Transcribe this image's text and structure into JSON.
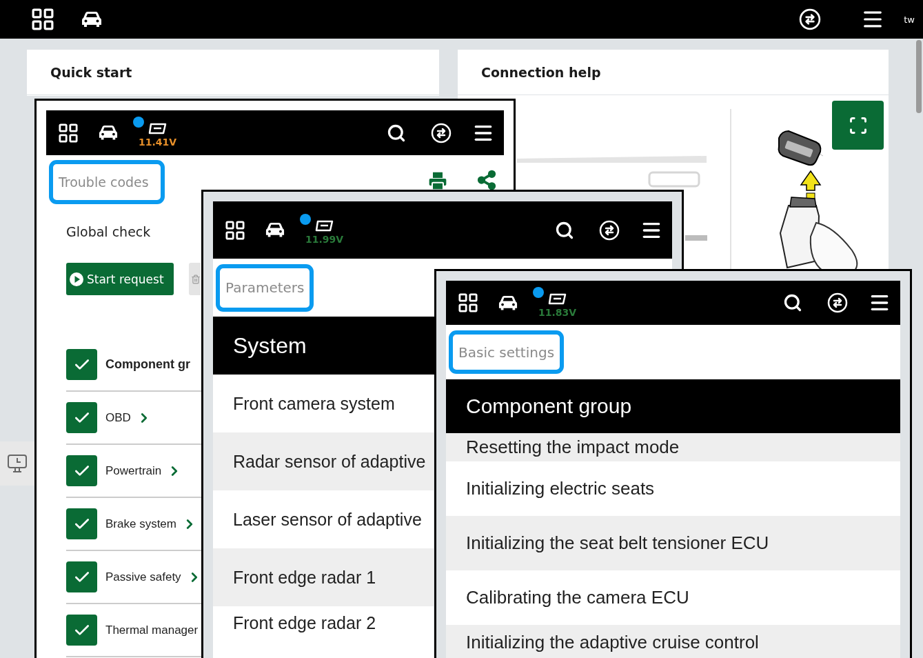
{
  "top_bar": {
    "user": "tw"
  },
  "cards": [
    {
      "title": "Quick start"
    },
    {
      "title": "Connection help"
    }
  ],
  "screenshots": [
    {
      "kind": "trouble_codes",
      "voltage": "11.41V",
      "color": "#e8902a",
      "field": "Trouble codes",
      "section": "Global check",
      "start_button": "Start request",
      "header_row": {
        "label": "Component gr",
        "checked": true
      },
      "rows": [
        {
          "label": "OBD",
          "checked": true
        },
        {
          "label": "Powertrain",
          "checked": true
        },
        {
          "label": "Brake system",
          "checked": true
        },
        {
          "label": "Passive safety",
          "checked": true
        },
        {
          "label": "Thermal manager",
          "checked": true
        }
      ]
    },
    {
      "kind": "list",
      "voltage": "11.99V",
      "color": "#2a7a3a",
      "field": "Parameters",
      "section": "System",
      "rows": [
        {
          "label": "Front camera system"
        },
        {
          "label": "Radar sensor of adaptive"
        },
        {
          "label": "Laser sensor of adaptive"
        },
        {
          "label": "Front edge radar 1"
        },
        {
          "label": "Front edge radar 2"
        }
      ]
    },
    {
      "kind": "list",
      "voltage": "11.83V",
      "color": "#2a7a3a",
      "field": "Basic settings",
      "section": "Component group",
      "partial_row": "Resetting the impact mode",
      "rows": [
        {
          "label": "Initializing electric seats"
        },
        {
          "label": "Initializing the seat belt tensioner ECU"
        },
        {
          "label": "Calibrating the camera ECU"
        },
        {
          "label": "Initializing the adaptive cruise control"
        }
      ]
    }
  ]
}
